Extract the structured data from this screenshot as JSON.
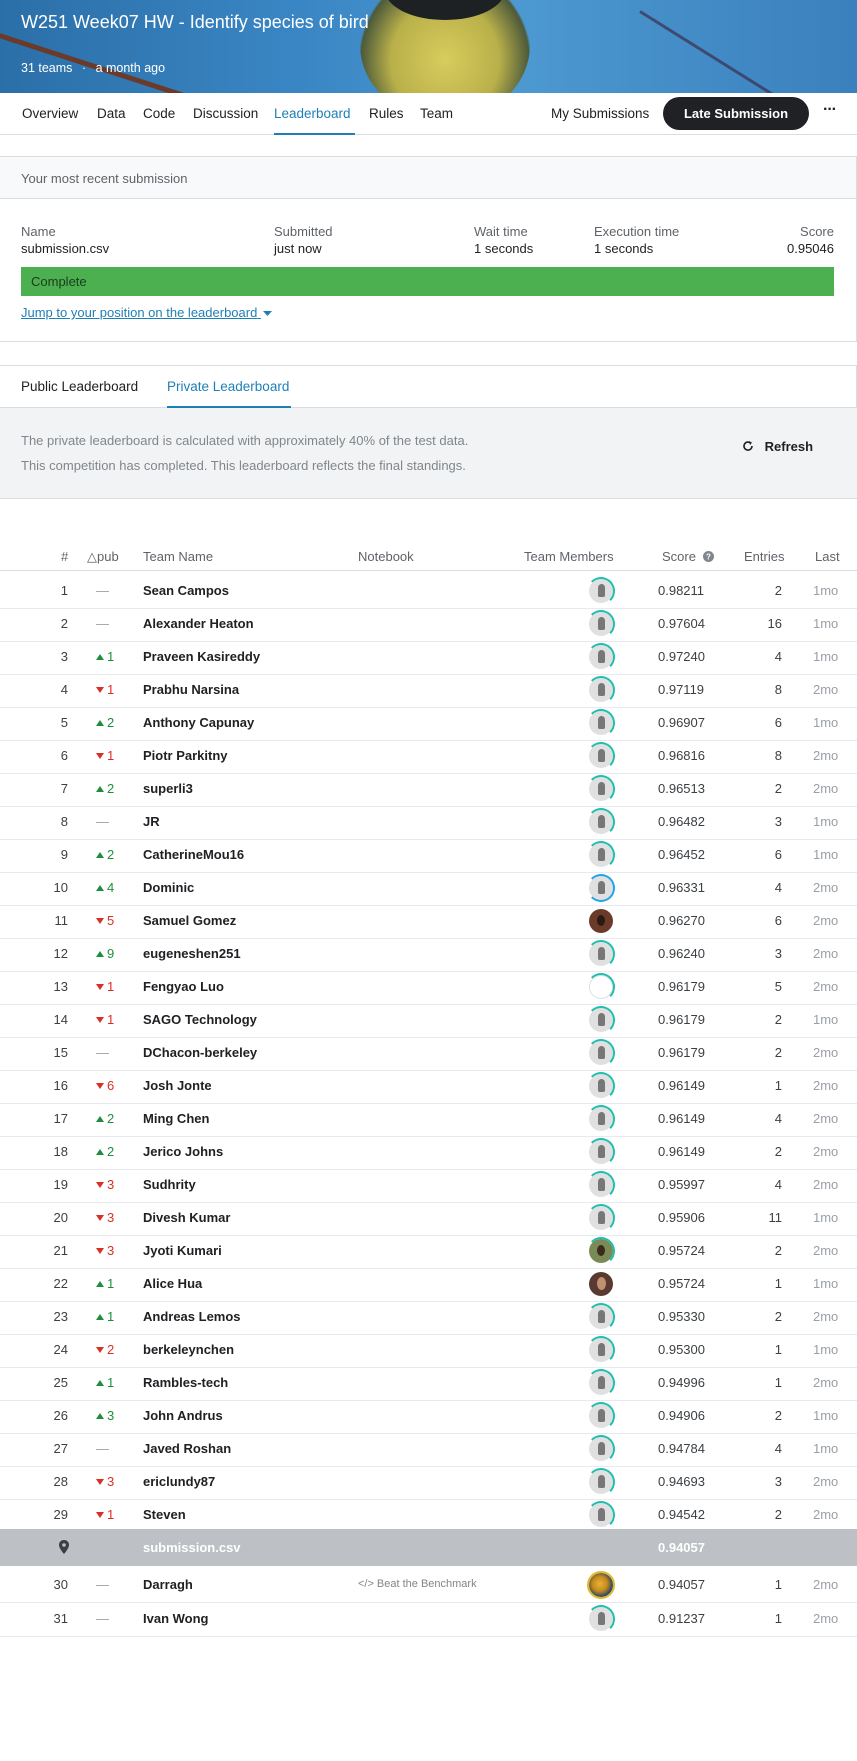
{
  "header": {
    "title": "W251 Week07 HW - Identify species of bird",
    "teams": "31 teams",
    "separator": "·",
    "time": "a month ago"
  },
  "nav": {
    "tabs": [
      "Overview",
      "Data",
      "Code",
      "Discussion",
      "Leaderboard",
      "Rules",
      "Team"
    ],
    "active_tab": "Leaderboard",
    "my_submissions": "My Submissions",
    "late_submission": "Late Submission",
    "more": "···"
  },
  "submission": {
    "heading": "Your most recent submission",
    "name_label": "Name",
    "name_value": "submission.csv",
    "submitted_label": "Submitted",
    "submitted_value": "just now",
    "wait_label": "Wait time",
    "wait_value": "1 seconds",
    "exec_label": "Execution time",
    "exec_value": "1 seconds",
    "score_label": "Score",
    "score_value": "0.95046",
    "status": "Complete",
    "status_color": "#4caf50",
    "jump_link": "Jump to your position on the leaderboard"
  },
  "leaderboard": {
    "tabs": [
      "Public Leaderboard",
      "Private Leaderboard"
    ],
    "active_tab": "Private Leaderboard",
    "info_line1": "The private leaderboard is calculated with approximately 40% of the test data.",
    "info_line2": "This competition has completed. This leaderboard reflects the final standings.",
    "refresh": "Refresh",
    "columns": {
      "rank": "#",
      "delta": "△pub",
      "team": "Team Name",
      "notebook": "Notebook",
      "members": "Team Members",
      "score": "Score",
      "entries": "Entries",
      "last": "Last"
    },
    "rows": [
      {
        "rank": "1",
        "dir": "none",
        "delta": "—",
        "team": "Sean Campos",
        "avatar": "default",
        "score": "0.98211",
        "entries": "2",
        "last": "1mo"
      },
      {
        "rank": "2",
        "dir": "none",
        "delta": "—",
        "team": "Alexander Heaton",
        "avatar": "default",
        "score": "0.97604",
        "entries": "16",
        "last": "1mo"
      },
      {
        "rank": "3",
        "dir": "up",
        "delta": "1",
        "team": "Praveen Kasireddy",
        "avatar": "default",
        "score": "0.97240",
        "entries": "4",
        "last": "1mo"
      },
      {
        "rank": "4",
        "dir": "down",
        "delta": "1",
        "team": "Prabhu Narsina",
        "avatar": "default",
        "score": "0.97119",
        "entries": "8",
        "last": "2mo"
      },
      {
        "rank": "5",
        "dir": "up",
        "delta": "2",
        "team": "Anthony Capunay",
        "avatar": "default",
        "score": "0.96907",
        "entries": "6",
        "last": "1mo"
      },
      {
        "rank": "6",
        "dir": "down",
        "delta": "1",
        "team": "Piotr Parkitny",
        "avatar": "default",
        "score": "0.96816",
        "entries": "8",
        "last": "2mo"
      },
      {
        "rank": "7",
        "dir": "up",
        "delta": "2",
        "team": "superli3",
        "avatar": "default",
        "score": "0.96513",
        "entries": "2",
        "last": "2mo"
      },
      {
        "rank": "8",
        "dir": "none",
        "delta": "—",
        "team": "JR",
        "avatar": "default",
        "score": "0.96482",
        "entries": "3",
        "last": "1mo"
      },
      {
        "rank": "9",
        "dir": "up",
        "delta": "2",
        "team": "CatherineMou16",
        "avatar": "default",
        "score": "0.96452",
        "entries": "6",
        "last": "1mo"
      },
      {
        "rank": "10",
        "dir": "up",
        "delta": "4",
        "team": "Dominic",
        "avatar": "default",
        "ring": "blue",
        "score": "0.96331",
        "entries": "4",
        "last": "2mo"
      },
      {
        "rank": "11",
        "dir": "down",
        "delta": "5",
        "team": "Samuel Gomez",
        "avatar": "photo",
        "ring": "none",
        "score": "0.96270",
        "entries": "6",
        "last": "2mo"
      },
      {
        "rank": "12",
        "dir": "up",
        "delta": "9",
        "team": "eugeneshen251",
        "avatar": "default",
        "score": "0.96240",
        "entries": "3",
        "last": "2mo"
      },
      {
        "rank": "13",
        "dir": "down",
        "delta": "1",
        "team": "Fengyao Luo",
        "avatar": "blank",
        "score": "0.96179",
        "entries": "5",
        "last": "2mo"
      },
      {
        "rank": "14",
        "dir": "down",
        "delta": "1",
        "team": "SAGO Technology",
        "avatar": "default",
        "score": "0.96179",
        "entries": "2",
        "last": "1mo"
      },
      {
        "rank": "15",
        "dir": "none",
        "delta": "—",
        "team": "DChacon-berkeley",
        "avatar": "default",
        "score": "0.96179",
        "entries": "2",
        "last": "2mo"
      },
      {
        "rank": "16",
        "dir": "down",
        "delta": "6",
        "team": "Josh Jonte",
        "avatar": "default",
        "score": "0.96149",
        "entries": "1",
        "last": "2mo"
      },
      {
        "rank": "17",
        "dir": "up",
        "delta": "2",
        "team": "Ming Chen",
        "avatar": "default",
        "score": "0.96149",
        "entries": "4",
        "last": "2mo"
      },
      {
        "rank": "18",
        "dir": "up",
        "delta": "2",
        "team": "Jerico Johns",
        "avatar": "default",
        "score": "0.96149",
        "entries": "2",
        "last": "2mo"
      },
      {
        "rank": "19",
        "dir": "down",
        "delta": "3",
        "team": "Sudhrity",
        "avatar": "default",
        "score": "0.95997",
        "entries": "4",
        "last": "2mo"
      },
      {
        "rank": "20",
        "dir": "down",
        "delta": "3",
        "team": "Divesh Kumar",
        "avatar": "default",
        "score": "0.95906",
        "entries": "11",
        "last": "1mo"
      },
      {
        "rank": "21",
        "dir": "down",
        "delta": "3",
        "team": "Jyoti Kumari",
        "avatar": "photo2",
        "score": "0.95724",
        "entries": "2",
        "last": "2mo"
      },
      {
        "rank": "22",
        "dir": "up",
        "delta": "1",
        "team": "Alice Hua",
        "avatar": "photo3",
        "ring": "none",
        "score": "0.95724",
        "entries": "1",
        "last": "1mo"
      },
      {
        "rank": "23",
        "dir": "up",
        "delta": "1",
        "team": "Andreas Lemos",
        "avatar": "default",
        "score": "0.95330",
        "entries": "2",
        "last": "2mo"
      },
      {
        "rank": "24",
        "dir": "down",
        "delta": "2",
        "team": "berkeleynchen",
        "avatar": "default",
        "score": "0.95300",
        "entries": "1",
        "last": "1mo"
      },
      {
        "rank": "25",
        "dir": "up",
        "delta": "1",
        "team": "Rambles-tech",
        "avatar": "default",
        "score": "0.94996",
        "entries": "1",
        "last": "2mo"
      },
      {
        "rank": "26",
        "dir": "up",
        "delta": "3",
        "team": "John Andrus",
        "avatar": "default",
        "score": "0.94906",
        "entries": "2",
        "last": "1mo"
      },
      {
        "rank": "27",
        "dir": "none",
        "delta": "—",
        "team": "Javed Roshan",
        "avatar": "default",
        "score": "0.94784",
        "entries": "4",
        "last": "1mo"
      },
      {
        "rank": "28",
        "dir": "down",
        "delta": "3",
        "team": "ericlundy87",
        "avatar": "default",
        "score": "0.94693",
        "entries": "3",
        "last": "2mo"
      },
      {
        "rank": "29",
        "dir": "down",
        "delta": "1",
        "team": "Steven",
        "avatar": "default",
        "score": "0.94542",
        "entries": "2",
        "last": "2mo"
      }
    ],
    "my_row": {
      "team": "submission.csv",
      "score": "0.94057"
    },
    "rows_after": [
      {
        "rank": "30",
        "dir": "none",
        "delta": "—",
        "team": "Darragh",
        "notebook": "Beat the Benchmark",
        "avatar": "globe",
        "ring": "gold",
        "score": "0.94057",
        "entries": "1",
        "last": "2mo"
      },
      {
        "rank": "31",
        "dir": "none",
        "delta": "—",
        "team": "Ivan Wong",
        "avatar": "default",
        "score": "0.91237",
        "entries": "1",
        "last": "2mo"
      }
    ]
  }
}
